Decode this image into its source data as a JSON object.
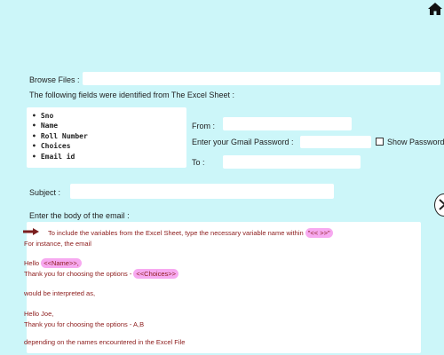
{
  "browse": {
    "label": "Browse Files :",
    "value": ""
  },
  "fields_heading": "The following fields were identified from The Excel Sheet :",
  "fields": [
    "Sno",
    "Name",
    "Roll Number",
    "Choices",
    "Email id"
  ],
  "from": {
    "label": "From :",
    "value": ""
  },
  "password": {
    "label": "Enter your Gmail Password :",
    "value": ""
  },
  "show_password_label": "Show Password",
  "to": {
    "label": "To :",
    "value": ""
  },
  "subject": {
    "label": "Subject :",
    "value": ""
  },
  "body_label": "Enter the body of the email :",
  "body": {
    "intro_text": "To include the variables from the Excel Sheet, type the necessary variable name within ",
    "intro_marker": "\"<< >>\"",
    "line2": "For instance, the email",
    "hello_prefix": "Hello ",
    "hello_var": "<<Name>>,",
    "thanks_text": "Thank you for choosing the options - ",
    "thanks_var": "<<Choices>>",
    "interpreted": "would be interpreted as,",
    "hello_joe": "Hello Joe,",
    "thanks_ab": "Thank you for choosing the options - A,B",
    "depending": "depending on the names encountered in the Excel File"
  },
  "icons": {
    "home": "home-icon",
    "arrow": "right-arrow-icon",
    "scroll": "chevron-right-icon"
  },
  "colors": {
    "background": "#ccf6f9",
    "body_text": "#8b1a1a",
    "highlight": "#f7a9f0",
    "arrow": "#7a1f1f"
  }
}
